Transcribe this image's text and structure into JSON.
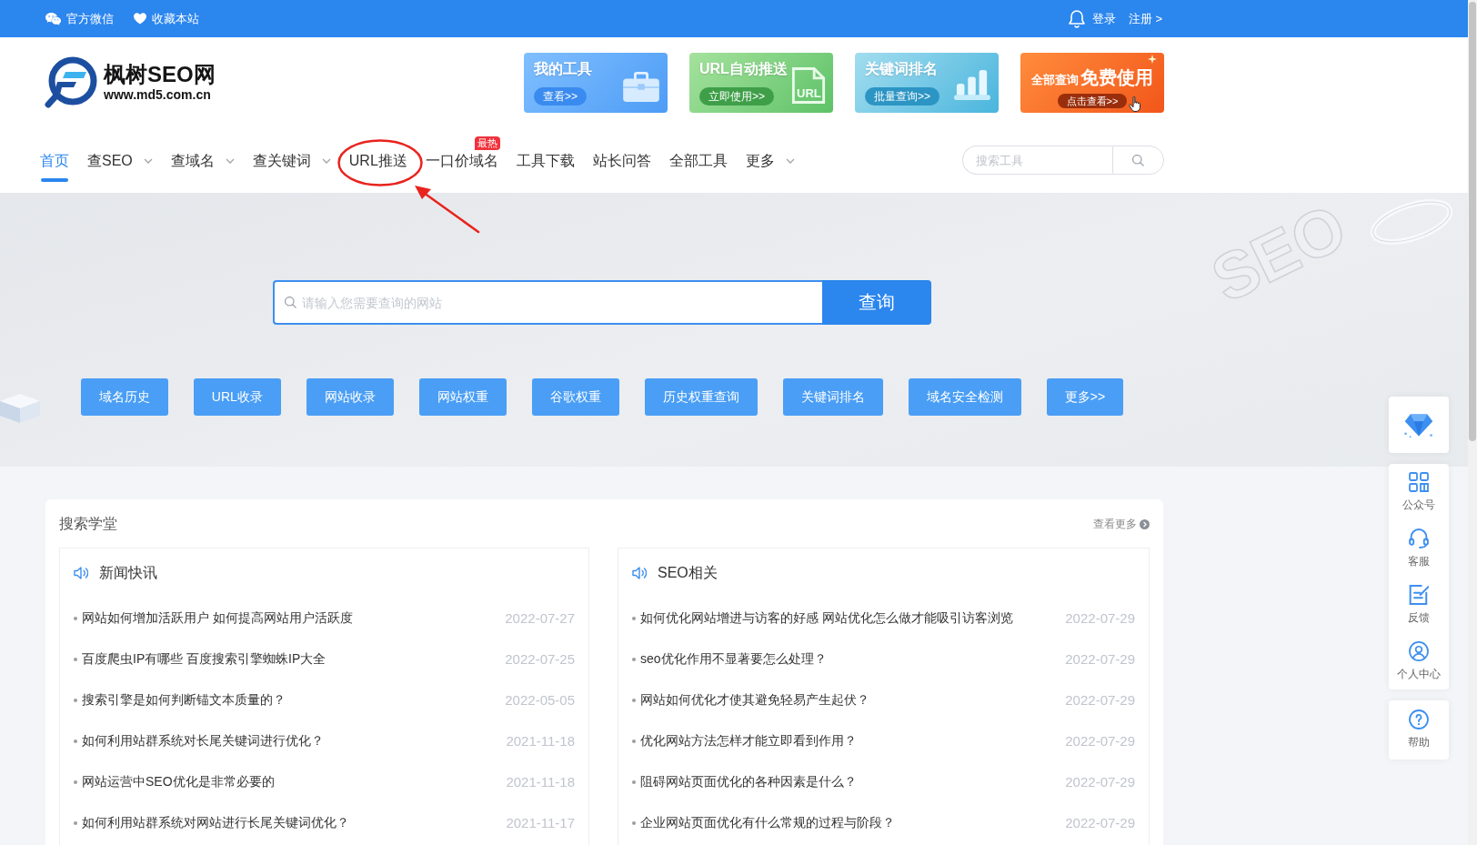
{
  "top_bar": {
    "links": [
      {
        "kind": "wechat",
        "label": "官方微信"
      },
      {
        "kind": "favorite",
        "label": "收藏本站"
      }
    ],
    "account_links": [
      "登录",
      "注册 >"
    ]
  },
  "header": {
    "logo": {
      "name": "枫树SEO网",
      "url": "www.md5.com.cn"
    },
    "banners": [
      {
        "kind": "tools",
        "title": "我的工具",
        "button": "查看>>"
      },
      {
        "kind": "push",
        "title": "URL自动推送",
        "button": "立即使用>>",
        "icon_text": "URL"
      },
      {
        "kind": "rank",
        "title": "关键词排名",
        "button": "批量查询>>"
      },
      {
        "kind": "promo",
        "title": "全部查询",
        "highlight": "免费使用",
        "button": "点击查看>>"
      }
    ]
  },
  "nav": {
    "items": [
      {
        "label": "首页",
        "selected": true,
        "has_menu": false,
        "annotated": false
      },
      {
        "label": "查SEO",
        "selected": false,
        "has_menu": true,
        "annotated": false
      },
      {
        "label": "查域名",
        "selected": false,
        "has_menu": true,
        "annotated": false
      },
      {
        "label": "查关键词",
        "selected": false,
        "has_menu": true,
        "annotated": false
      },
      {
        "label": "URL推送",
        "selected": false,
        "has_menu": false,
        "annotated": true
      },
      {
        "label": "一口价域名",
        "selected": false,
        "has_menu": false,
        "annotated": false,
        "badge": "最热"
      },
      {
        "label": "工具下载",
        "selected": false,
        "has_menu": false,
        "annotated": false
      },
      {
        "label": "站长问答",
        "selected": false,
        "has_menu": false,
        "annotated": false
      },
      {
        "label": "全部工具",
        "selected": false,
        "has_menu": false,
        "annotated": false
      },
      {
        "label": "更多",
        "selected": false,
        "has_menu": true,
        "annotated": false
      }
    ],
    "search": {
      "placeholder": "搜索工具"
    }
  },
  "hero": {
    "decoration_text": "SEO",
    "search": {
      "placeholder": "请输入您需要查询的网站",
      "button": "查询"
    },
    "quick_tools": [
      "域名历史",
      "URL收录",
      "网站收录",
      "网站权重",
      "谷歌权重",
      "历史权重查询",
      "关键词排名",
      "域名安全检测",
      "更多>>"
    ]
  },
  "learning": {
    "title": "搜索学堂",
    "more": "查看更多",
    "panels": [
      {
        "title": "新闻快讯",
        "articles": [
          {
            "title": "网站如何增加活跃用户 如何提高网站用户活跃度",
            "date": "2022-07-27"
          },
          {
            "title": "百度爬虫IP有哪些 百度搜索引擎蜘蛛IP大全",
            "date": "2022-07-25"
          },
          {
            "title": "搜索引擎是如何判断锚文本质量的？",
            "date": "2022-05-05"
          },
          {
            "title": "如何利用站群系统对长尾关键词进行优化？",
            "date": "2021-11-18"
          },
          {
            "title": "网站运营中SEO优化是非常必要的",
            "date": "2021-11-18"
          },
          {
            "title": "如何利用站群系统对网站进行长尾关键词优化？",
            "date": "2021-11-17"
          }
        ]
      },
      {
        "title": "SEO相关",
        "articles": [
          {
            "title": "如何优化网站增进与访客的好感 网站优化怎么做才能吸引访客浏览",
            "date": "2022-07-29"
          },
          {
            "title": "seo优化作用不显著要怎么处理？",
            "date": "2022-07-29"
          },
          {
            "title": "网站如何优化才使其避免轻易产生起伏？",
            "date": "2022-07-29"
          },
          {
            "title": "优化网站方法怎样才能立即看到作用？",
            "date": "2022-07-29"
          },
          {
            "title": "阻碍网站页面优化的各种因素是什么？",
            "date": "2022-07-29"
          },
          {
            "title": "企业网站页面优化有什么常规的过程与阶段？",
            "date": "2022-07-29"
          }
        ]
      }
    ]
  },
  "side_toolbar": {
    "groups": [
      {
        "items": [
          {
            "kind": "vip"
          }
        ]
      },
      {
        "items": [
          {
            "kind": "qr",
            "label": "公众号"
          },
          {
            "kind": "service",
            "label": "客服"
          },
          {
            "kind": "feedback",
            "label": "反馈"
          },
          {
            "kind": "account",
            "label": "个人中心"
          }
        ]
      },
      {
        "items": [
          {
            "kind": "help",
            "label": "帮助"
          }
        ]
      }
    ]
  }
}
